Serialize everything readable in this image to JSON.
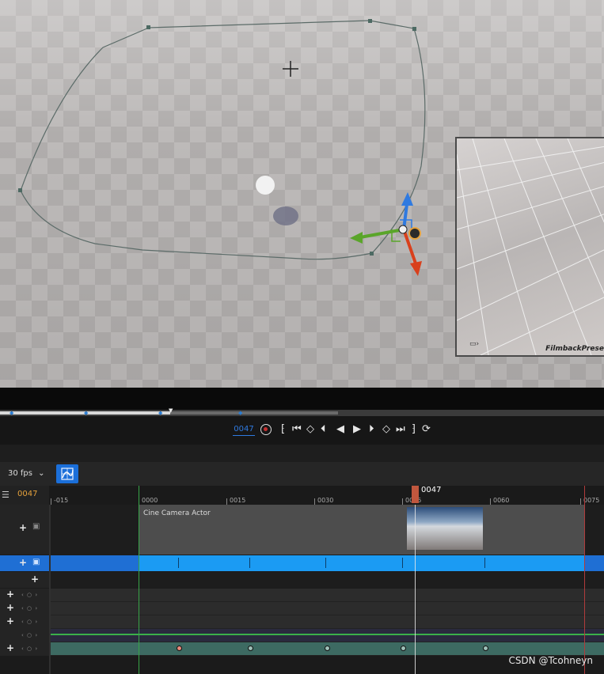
{
  "viewport": {
    "preview_label": "FilmbackPrese",
    "camera_icon": "camera-icon"
  },
  "transport": {
    "current_frame": "0047"
  },
  "toolbar": {
    "fps_label": "30 fps",
    "fps_caret": "⌄"
  },
  "ruler": {
    "current_frame": "0047",
    "playhead_label": "0047",
    "ticks": [
      "-015",
      "0000",
      "0015",
      "0030",
      "0045",
      "0060",
      "0075"
    ]
  },
  "tracks": {
    "shot_name": "Cine Camera Actor",
    "plus": "+",
    "sub_ctrl": "‹ ○ ›"
  },
  "watermark": "CSDN @Tcohneyn",
  "colors": {
    "accent_blue": "#1b9bf3",
    "playhead": "#c0573e",
    "current_frame": "#e6a23c",
    "start_marker": "#38a548",
    "end_marker": "#b03b3b"
  }
}
